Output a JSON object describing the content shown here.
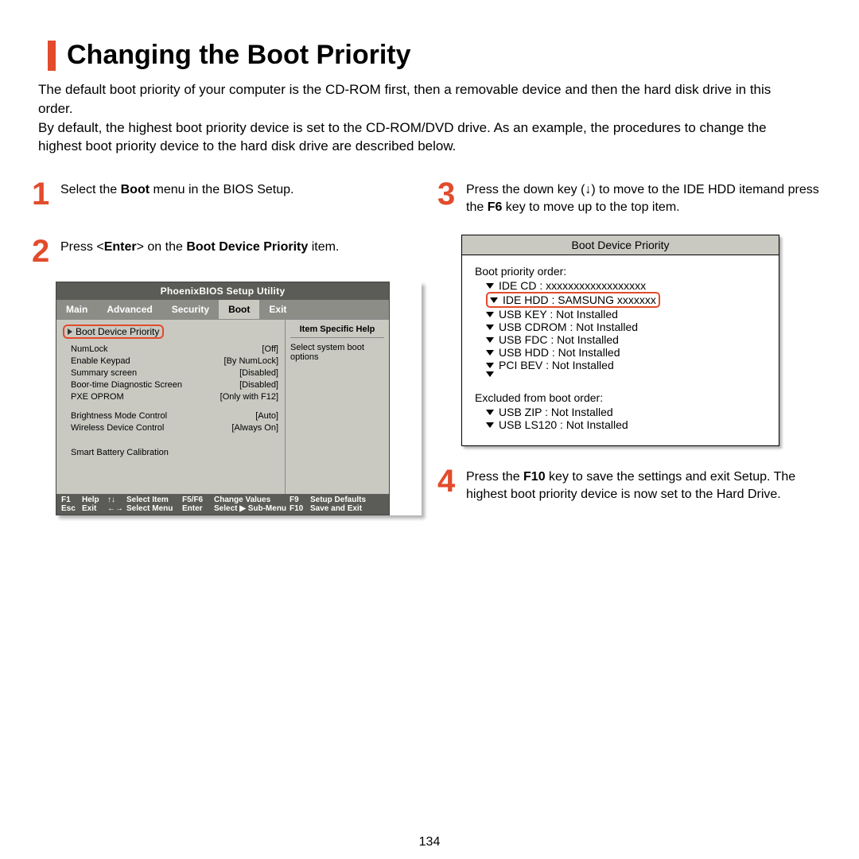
{
  "title": "Changing the Boot Priority",
  "intro_p1": "The default boot priority of your computer is the CD-ROM first, then a removable device and then the hard disk drive in this order.",
  "intro_p2": "By default, the highest boot priority device is set to the CD-ROM/DVD drive. As an example, the procedures to change the highest boot priority device to the hard disk drive are described below.",
  "steps": {
    "s1": {
      "num": "1",
      "pre": "Select the ",
      "bold": "Boot",
      "post": " menu in the BIOS Setup."
    },
    "s2": {
      "num": "2",
      "pre": "Press <",
      "b1": "Enter",
      "mid": "> on the ",
      "b2": "Boot Device Priority",
      "post": " item."
    },
    "s3": {
      "num": "3",
      "pre": "Press the down key (↓) to move to the IDE HDD itemand press the ",
      "bold": "F6",
      "post": " key to move up to the top item."
    },
    "s4": {
      "num": "4",
      "pre": "Press the ",
      "bold": "F10",
      "post": " key to save the settings and exit Setup. The highest boot priority device is now set to the Hard Drive."
    }
  },
  "bios": {
    "title": "PhoenixBIOS Setup Utility",
    "tabs": [
      "Main",
      "Advanced",
      "Security",
      "Boot",
      "Exit"
    ],
    "active_tab_index": 3,
    "highlighted_item": "Boot Device Priority",
    "items": [
      {
        "label": "NumLock",
        "value": "[Off]"
      },
      {
        "label": "Enable Keypad",
        "value": "[By NumLock]"
      },
      {
        "label": "Summary screen",
        "value": "[Disabled]"
      },
      {
        "label": "Boor-time Diagnostic Screen",
        "value": "[Disabled]"
      },
      {
        "label": "PXE OPROM",
        "value": "[Only with F12]"
      }
    ],
    "items2": [
      {
        "label": "Brightness Mode Control",
        "value": "[Auto]"
      },
      {
        "label": "Wireless Device Control",
        "value": "[Always On]"
      }
    ],
    "items3": [
      {
        "label": "Smart Battery Calibration",
        "value": ""
      }
    ],
    "help_title": "Item Specific Help",
    "help_text": "Select system boot options",
    "footer": {
      "r1": [
        "F1",
        "Help",
        "↑↓",
        "Select Item",
        "F5/F6",
        "Change Values",
        "F9",
        "Setup Defaults"
      ],
      "r2": [
        "Esc",
        "Exit",
        "←→",
        "Select Menu",
        "Enter",
        "Select ▶ Sub-Menu",
        "F10",
        "Save and Exit"
      ]
    }
  },
  "bdp": {
    "title": "Boot Device Priority",
    "label1": "Boot priority order:",
    "priority": [
      "IDE CD : xxxxxxxxxxxxxxxxxx",
      "IDE HDD : SAMSUNG xxxxxxx",
      "USB KEY : Not Installed",
      "USB CDROM : Not Installed",
      "USB FDC : Not Installed",
      "USB HDD : Not Installed",
      "PCI BEV : Not Installed",
      ""
    ],
    "highlighted_index": 1,
    "label2": "Excluded from boot order:",
    "excluded": [
      "USB ZIP : Not Installed",
      "USB LS120 : Not Installed"
    ]
  },
  "page_number": "134"
}
